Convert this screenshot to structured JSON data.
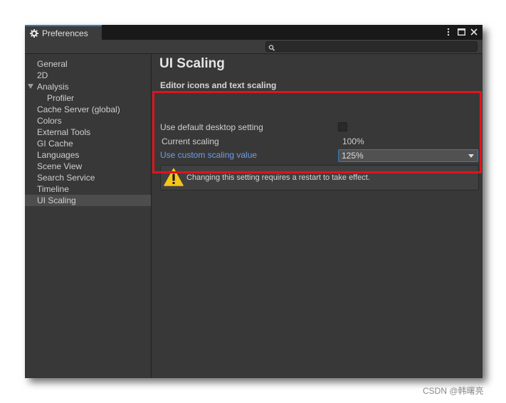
{
  "window": {
    "tab_title": "Preferences",
    "tab_icon": "gear-icon",
    "controls": [
      "more-options-icon",
      "maximize-icon",
      "close-icon"
    ]
  },
  "search": {
    "placeholder": "",
    "value": ""
  },
  "sidebar": {
    "items": [
      {
        "label": "General",
        "selected": false
      },
      {
        "label": "2D",
        "selected": false
      },
      {
        "label": "Analysis",
        "selected": false,
        "expanded": true
      },
      {
        "label": "Profiler",
        "selected": false,
        "child": true
      },
      {
        "label": "Cache Server (global)",
        "selected": false
      },
      {
        "label": "Colors",
        "selected": false
      },
      {
        "label": "External Tools",
        "selected": false
      },
      {
        "label": "GI Cache",
        "selected": false
      },
      {
        "label": "Languages",
        "selected": false
      },
      {
        "label": "Scene View",
        "selected": false
      },
      {
        "label": "Search Service",
        "selected": false
      },
      {
        "label": "Timeline",
        "selected": false
      },
      {
        "label": "UI Scaling",
        "selected": true
      }
    ]
  },
  "main": {
    "title": "UI Scaling",
    "section_title": "Editor icons and text scaling",
    "use_default_label": "Use default desktop setting",
    "use_default_checked": false,
    "current_scaling_label": "Current scaling",
    "current_scaling_value": "100%",
    "custom_scaling_label": "Use custom scaling value",
    "custom_scaling_value": "125%",
    "warning_message": "Changing this setting requires a restart to take effect."
  },
  "annotation": {
    "highlight_color": "#e0141c"
  },
  "watermark": "CSDN @韩曙亮",
  "colors": {
    "window_bg": "#383838",
    "accent": "#3a79bb",
    "link": "#6e9ee8",
    "warning": "#f5c518"
  }
}
